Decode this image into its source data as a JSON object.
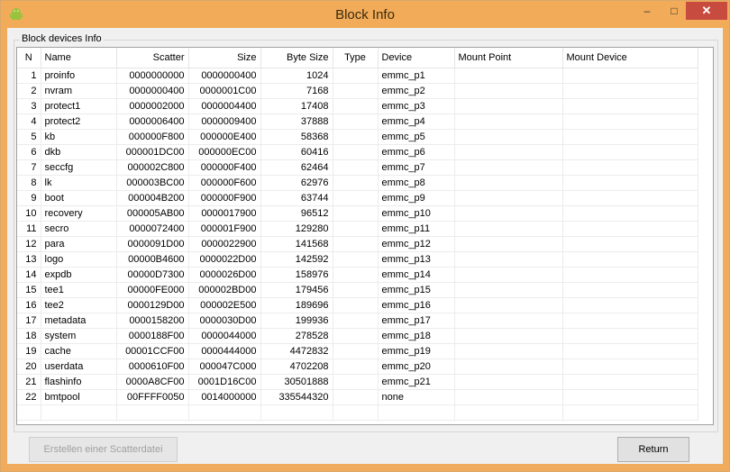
{
  "window": {
    "title": "Block Info",
    "min_glyph": "–",
    "max_glyph": "□",
    "close_glyph": "✕"
  },
  "group": {
    "label": "Block devices Info"
  },
  "table": {
    "columns": [
      "N",
      "Name",
      "Scatter",
      "Size",
      "Byte Size",
      "Type",
      "Device",
      "Mount Point",
      "Mount Device"
    ],
    "rows": [
      [
        "1",
        "proinfo",
        "0000000000",
        "0000000400",
        "1024",
        "",
        "emmc_p1",
        "",
        ""
      ],
      [
        "2",
        "nvram",
        "0000000400",
        "0000001C00",
        "7168",
        "",
        "emmc_p2",
        "",
        ""
      ],
      [
        "3",
        "protect1",
        "0000002000",
        "0000004400",
        "17408",
        "",
        "emmc_p3",
        "",
        ""
      ],
      [
        "4",
        "protect2",
        "0000006400",
        "0000009400",
        "37888",
        "",
        "emmc_p4",
        "",
        ""
      ],
      [
        "5",
        "kb",
        "000000F800",
        "000000E400",
        "58368",
        "",
        "emmc_p5",
        "",
        ""
      ],
      [
        "6",
        "dkb",
        "000001DC00",
        "000000EC00",
        "60416",
        "",
        "emmc_p6",
        "",
        ""
      ],
      [
        "7",
        "seccfg",
        "000002C800",
        "000000F400",
        "62464",
        "",
        "emmc_p7",
        "",
        ""
      ],
      [
        "8",
        "lk",
        "000003BC00",
        "000000F600",
        "62976",
        "",
        "emmc_p8",
        "",
        ""
      ],
      [
        "9",
        "boot",
        "000004B200",
        "000000F900",
        "63744",
        "",
        "emmc_p9",
        "",
        ""
      ],
      [
        "10",
        "recovery",
        "000005AB00",
        "0000017900",
        "96512",
        "",
        "emmc_p10",
        "",
        ""
      ],
      [
        "11",
        "secro",
        "0000072400",
        "000001F900",
        "129280",
        "",
        "emmc_p11",
        "",
        ""
      ],
      [
        "12",
        "para",
        "0000091D00",
        "0000022900",
        "141568",
        "",
        "emmc_p12",
        "",
        ""
      ],
      [
        "13",
        "logo",
        "00000B4600",
        "0000022D00",
        "142592",
        "",
        "emmc_p13",
        "",
        ""
      ],
      [
        "14",
        "expdb",
        "00000D7300",
        "0000026D00",
        "158976",
        "",
        "emmc_p14",
        "",
        ""
      ],
      [
        "15",
        "tee1",
        "00000FE000",
        "000002BD00",
        "179456",
        "",
        "emmc_p15",
        "",
        ""
      ],
      [
        "16",
        "tee2",
        "0000129D00",
        "000002E500",
        "189696",
        "",
        "emmc_p16",
        "",
        ""
      ],
      [
        "17",
        "metadata",
        "0000158200",
        "0000030D00",
        "199936",
        "",
        "emmc_p17",
        "",
        ""
      ],
      [
        "18",
        "system",
        "0000188F00",
        "0000044000",
        "278528",
        "",
        "emmc_p18",
        "",
        ""
      ],
      [
        "19",
        "cache",
        "00001CCF00",
        "0000444000",
        "4472832",
        "",
        "emmc_p19",
        "",
        ""
      ],
      [
        "20",
        "userdata",
        "0000610F00",
        "000047C000",
        "4702208",
        "",
        "emmc_p20",
        "",
        ""
      ],
      [
        "21",
        "flashinfo",
        "0000A8CF00",
        "0001D16C00",
        "30501888",
        "",
        "emmc_p21",
        "",
        ""
      ],
      [
        "22",
        "bmtpool",
        "00FFFF0050",
        "0014000000",
        "335544320",
        "",
        "none",
        "",
        ""
      ]
    ]
  },
  "buttons": {
    "scatter": "Erstellen einer Scatterdatei",
    "return": "Return"
  },
  "colors": {
    "titlebar": "#f2ab58",
    "close": "#c74b3f"
  }
}
